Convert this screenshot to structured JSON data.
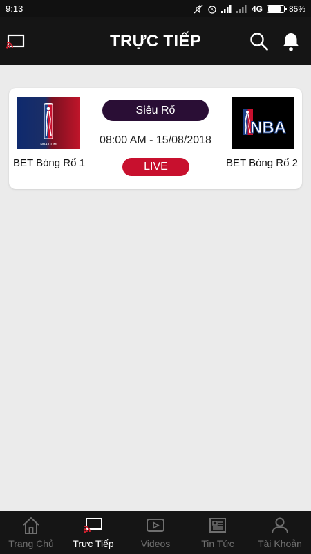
{
  "status_bar": {
    "time": "9:13",
    "network": "4G",
    "battery_percent": "85%",
    "battery_level": 0.85
  },
  "app_bar": {
    "title": "TRỰC TIẾP",
    "icons": [
      "cast-icon",
      "search-icon",
      "bell-icon"
    ]
  },
  "match": {
    "league": "Siêu Rổ",
    "datetime": "08:00 AM - 15/08/2018",
    "status": "LIVE",
    "home_team": "BET Bóng Rổ 1",
    "away_team": "BET Bóng Rổ 2",
    "logo_text": "NBA",
    "logo_subtext": "NBA.COM"
  },
  "bottom_nav": {
    "items": [
      {
        "label": "Trang Chủ",
        "icon": "home-icon"
      },
      {
        "label": "Trực Tiếp",
        "icon": "live-tv-icon"
      },
      {
        "label": "Videos",
        "icon": "video-play-icon"
      },
      {
        "label": "Tin Tức",
        "icon": "news-icon"
      },
      {
        "label": "Tài Khoản",
        "icon": "account-icon"
      }
    ],
    "active_index": 1
  },
  "colors": {
    "bar_background": "#151515",
    "page_background": "#ebebeb",
    "league_pill": "#2a0e35",
    "live_pill": "#c8102e",
    "cast_accent": "#d0202e"
  }
}
